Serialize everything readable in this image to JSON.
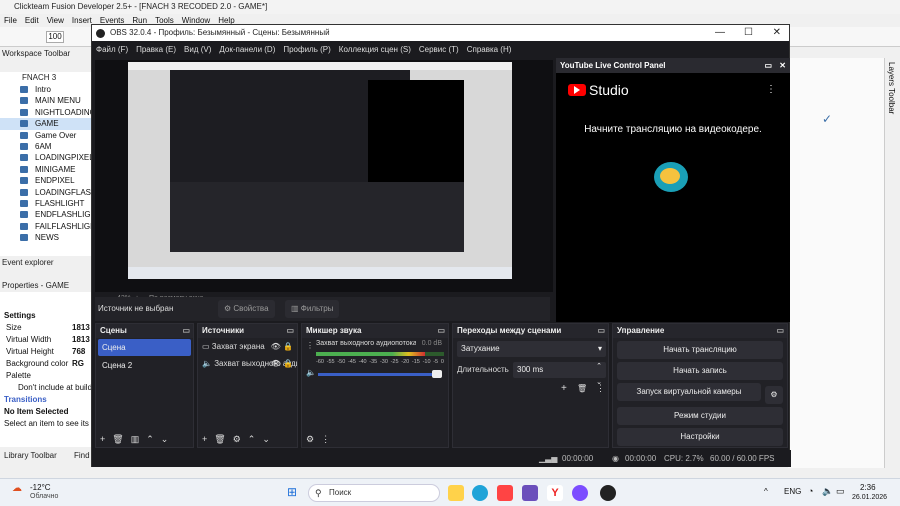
{
  "ctf": {
    "title": "Clickteam Fusion Developer 2.5+ - [FNACH 3 RECODED 2.0 - GAME*]",
    "menu": [
      "File",
      "Edit",
      "View",
      "Insert",
      "Events",
      "Run",
      "Tools",
      "Window",
      "Help"
    ],
    "zoom": "100",
    "workspace_toolbar": "Workspace Toolbar",
    "tree_root": "FNACH 3 RECODED",
    "frames": [
      "Intro",
      "MAIN MENU",
      "NIGHTLOADING",
      "GAME",
      "Game Over",
      "6AM",
      "LOADINGPIXEL",
      "MINIGAME",
      "ENDPIXEL",
      "LOADINGFLASHL",
      "FLASHLIGHT",
      "ENDFLASHLIGHT",
      "FAILFLASHLIGHT",
      "NEWS"
    ],
    "selected_frame": "GAME",
    "event_explorer": "Event explorer",
    "properties_title": "Properties - GAME",
    "settings_label": "Settings",
    "props": [
      {
        "k": "Size",
        "v": "1813"
      },
      {
        "k": "Virtual Width",
        "v": "1813"
      },
      {
        "k": "Virtual Height",
        "v": "768"
      },
      {
        "k": "Background color",
        "v": "RG"
      },
      {
        "k": "Palette",
        "v": ""
      }
    ],
    "dont_include": "Don't include at build",
    "transitions": "Transitions",
    "no_item": "No Item Selected",
    "no_item_hint": "Select an item to see its des",
    "library_toolbar": "Library Toolbar",
    "find": "Find",
    "right_title": "Layers Toolbar"
  },
  "obs": {
    "title": "OBS 32.0.4 - Профиль: Безымянный - Сцены: Безымянный",
    "menu": [
      "Файл (F)",
      "Правка (E)",
      "Вид (V)",
      "Док-панели (D)",
      "Профиль (P)",
      "Коллекция сцен (S)",
      "Сервис (T)",
      "Справка (H)"
    ],
    "zoom_pct": "42%",
    "zoom_mode": "По размеру окна",
    "no_source": "Источник не выбран",
    "properties_btn": "Свойства",
    "filters_btn": "Фильтры",
    "yt": {
      "head": "YouTube Live Control Panel",
      "brand": "Studio",
      "message": "Начните трансляцию на видеокодере."
    },
    "scenes": {
      "title": "Сцены",
      "items": [
        "Сцена",
        "Сцена 2"
      ],
      "active": "Сцена"
    },
    "sources": {
      "title": "Источники",
      "items": [
        "Захват экрана",
        "Захват выходного аудиопотока"
      ]
    },
    "mixer": {
      "title": "Микшер звука",
      "channel": "Захват выходного аудиопотока",
      "db": "0.0 dB",
      "scale": [
        "-60",
        "-55",
        "-50",
        "-45",
        "-40",
        "-35",
        "-30",
        "-25",
        "-20",
        "-15",
        "-10",
        "-5",
        "0"
      ],
      "level": 0.85
    },
    "transitions": {
      "title": "Переходы между сценами",
      "type": "Затухание",
      "duration_label": "Длительность",
      "duration": "300 ms"
    },
    "controls": {
      "title": "Управление",
      "buttons": [
        "Начать трансляцию",
        "Начать запись",
        "Запуск виртуальной камеры",
        "Режим студии",
        "Настройки"
      ]
    },
    "status": {
      "time1": "00:00:00",
      "time2": "00:00:00",
      "cpu": "CPU: 2.7%",
      "fps": "60.00 / 60.00 FPS"
    }
  },
  "taskbar": {
    "weather_temp": "-12°C",
    "weather_desc": "Облачно",
    "search": "Поиск",
    "lang": "ENG",
    "time": "2:36",
    "date": "26.01.2026"
  },
  "colors": {
    "accent": "#3a5fc6",
    "obs_bg": "#1b1b1f",
    "yt_red": "#ff0000"
  }
}
